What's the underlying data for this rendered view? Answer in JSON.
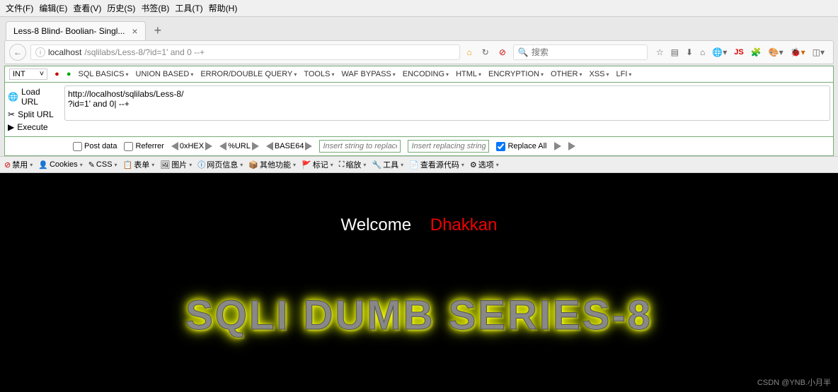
{
  "menubar": [
    "文件(F)",
    "编辑(E)",
    "查看(V)",
    "历史(S)",
    "书签(B)",
    "工具(T)",
    "帮助(H)"
  ],
  "tab": {
    "title": "Less-8 Blind- Boolian- Singl..."
  },
  "url": {
    "host": "localhost",
    "path": "/sqlilabs/Less-8/?id=1' and 0 --+"
  },
  "search": {
    "placeholder": "搜索"
  },
  "hackbar": {
    "type_select": "INT",
    "menus": [
      "SQL BASICS",
      "UNION BASED",
      "ERROR/DOUBLE QUERY",
      "TOOLS",
      "WAF BYPASS",
      "ENCODING",
      "HTML",
      "ENCRYPTION",
      "OTHER",
      "XSS",
      "LFI"
    ],
    "actions": {
      "load": "Load URL",
      "split": "Split URL",
      "execute": "Execute"
    },
    "url_value": "http://localhost/sqlilabs/Less-8/\n?id=1' and 0| --+",
    "tools": {
      "postdata": "Post data",
      "referrer": "Referrer",
      "hex": "0xHEX",
      "urlenc": "%URL",
      "base64": "BASE64",
      "insert1_ph": "Insert string to replace",
      "insert2_ph": "Insert replacing string",
      "replaceall": "Replace All"
    }
  },
  "webdev": {
    "forbid": "禁用",
    "cookies": "Cookies",
    "css": "CSS",
    "forms": "表单",
    "images": "图片",
    "info": "网页信息",
    "misc": "其他功能",
    "outline": "标记",
    "resize": "缩放",
    "tools": "工具",
    "source": "查看源代码",
    "options": "选项"
  },
  "page": {
    "welcome": "Welcome",
    "name": "Dhakkan",
    "series": "SQLI DUMB SERIES-8"
  },
  "watermark": "CSDN @YNB.小月半"
}
